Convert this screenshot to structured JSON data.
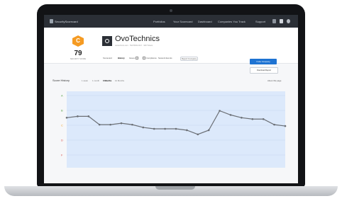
{
  "nav": {
    "brand": "SecurityScorecard",
    "items": [
      "Portfolios",
      "Your Scorecard",
      "Dashboard",
      "Companies You Track",
      "Support"
    ]
  },
  "header": {
    "grade": "C",
    "score": "79",
    "score_label": "SECURITY SCORE",
    "company_name": "OvoTechnics",
    "company_meta": "ovotechnics.com · TECHNOLOGY · 900 Tickets",
    "tabs": [
      "Scorecard",
      "History",
      "Issues",
      "Compliance",
      "Network Events",
      "Report Company"
    ],
    "active_tab": "History",
    "primary_button": "Invite Company",
    "secondary_button": "Download Report"
  },
  "history": {
    "title": "Score History",
    "ranges": [
      "1 week",
      "1 month",
      "3 Months",
      "12 Months"
    ],
    "active_range": "3 Months",
    "about_link": "About this page"
  },
  "colors": {
    "nav_bg": "#2b2f36",
    "grade": "#f59b23",
    "primary": "#1e73d2",
    "line": "#6b6f75",
    "band": "#dce9fb"
  },
  "chart_data": {
    "type": "line",
    "y_grade_labels": [
      "A",
      "B",
      "C",
      "D",
      "F"
    ],
    "values": [
      81,
      82,
      82,
      76,
      76,
      77,
      76,
      74,
      73,
      73,
      73,
      72,
      69,
      72,
      86,
      83,
      81,
      80,
      80,
      76,
      75
    ],
    "ylim": [
      45,
      100
    ],
    "grid": true
  }
}
